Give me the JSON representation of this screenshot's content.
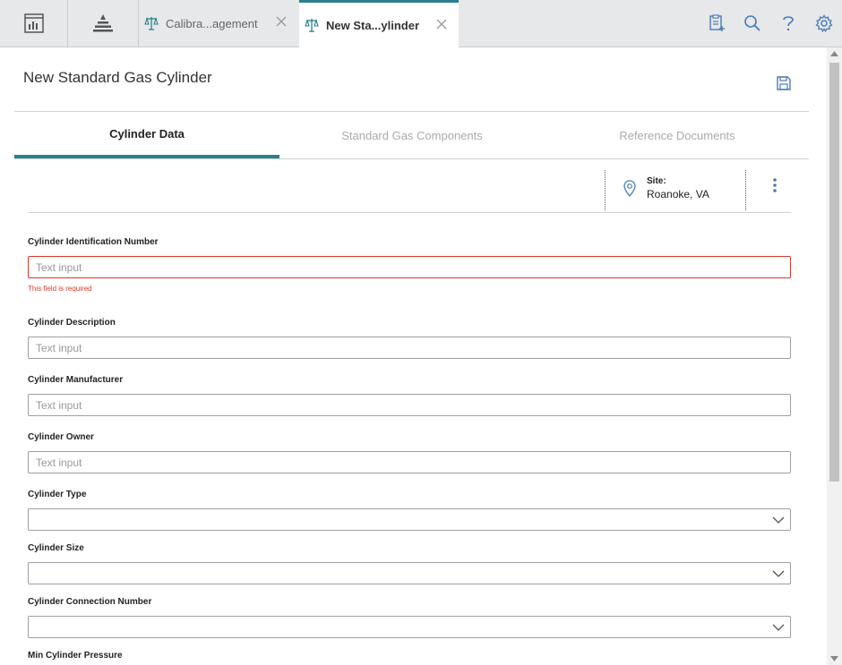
{
  "topbar": {
    "tabs": [
      {
        "label": "Calibra...agement",
        "active": false
      },
      {
        "label": "New Sta...ylinder",
        "active": true
      }
    ]
  },
  "page": {
    "title": "New Standard Gas Cylinder"
  },
  "content_tabs": [
    {
      "label": "Cylinder Data",
      "active": true
    },
    {
      "label": "Standard Gas Components",
      "active": false
    },
    {
      "label": "Reference Documents",
      "active": false
    }
  ],
  "site": {
    "label": "Site:",
    "value": "Roanoke, VA"
  },
  "form": {
    "cylinder_id": {
      "label": "Cylinder Identification Number",
      "placeholder": "Text input",
      "value": "",
      "error": "This field is required"
    },
    "description": {
      "label": "Cylinder Description",
      "placeholder": "Text input",
      "value": ""
    },
    "manufacturer": {
      "label": "Cylinder Manufacturer",
      "placeholder": "Text input",
      "value": ""
    },
    "owner": {
      "label": "Cylinder Owner",
      "placeholder": "Text input",
      "value": ""
    },
    "type": {
      "label": "Cylinder Type",
      "value": ""
    },
    "size": {
      "label": "Cylinder Size",
      "value": ""
    },
    "connection": {
      "label": "Cylinder Connection Number",
      "value": ""
    },
    "min_pressure": {
      "label": "Min Cylinder Pressure"
    }
  },
  "colors": {
    "accent": "#2a7f8f",
    "error": "#d9372b",
    "icon": "#4a7ab8"
  }
}
